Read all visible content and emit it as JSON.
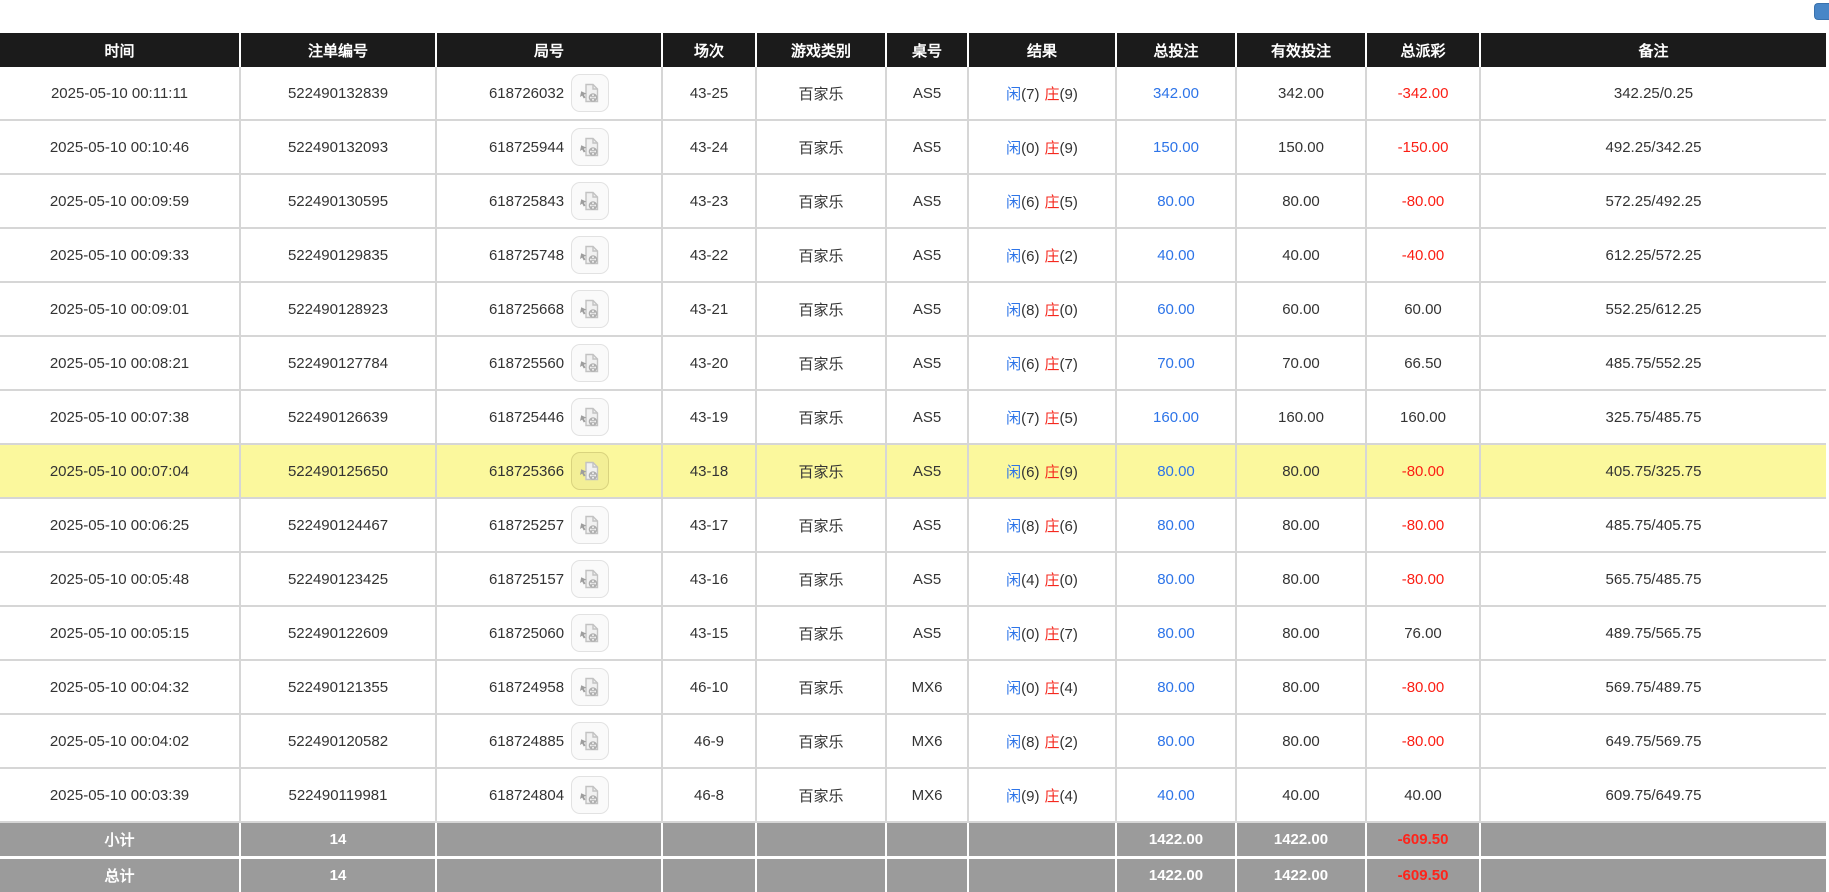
{
  "corner_tab": {
    "color": "#4886c7"
  },
  "colors": {
    "header_bg": "#1b1b1b",
    "highlight_row": "#fbf89d",
    "summary_bg": "#9b9b9b",
    "link_blue": "#2d74e8",
    "negative_red": "#fb1e14"
  },
  "result_labels": {
    "player": "闲",
    "banker": "庄"
  },
  "icons": {
    "round_action": "video-replay-icon"
  },
  "table": {
    "columns": [
      {
        "key": "time",
        "label": "时间"
      },
      {
        "key": "bet_no",
        "label": "注单编号"
      },
      {
        "key": "round_no",
        "label": "局号"
      },
      {
        "key": "session",
        "label": "场次"
      },
      {
        "key": "game",
        "label": "游戏类别"
      },
      {
        "key": "table",
        "label": "桌号"
      },
      {
        "key": "result",
        "label": "结果"
      },
      {
        "key": "total",
        "label": "总投注"
      },
      {
        "key": "valid",
        "label": "有效投注"
      },
      {
        "key": "payout",
        "label": "总派彩"
      },
      {
        "key": "remark",
        "label": "备注"
      }
    ],
    "rows": [
      {
        "time": "2025-05-10 00:11:11",
        "bet_no": "522490132839",
        "round_no": "618726032",
        "session": "43-25",
        "game": "百家乐",
        "table": "AS5",
        "player": "7",
        "banker": "9",
        "total": "342.00",
        "valid": "342.00",
        "payout": "-342.00",
        "remark": "342.25/0.25"
      },
      {
        "time": "2025-05-10 00:10:46",
        "bet_no": "522490132093",
        "round_no": "618725944",
        "session": "43-24",
        "game": "百家乐",
        "table": "AS5",
        "player": "0",
        "banker": "9",
        "total": "150.00",
        "valid": "150.00",
        "payout": "-150.00",
        "remark": "492.25/342.25"
      },
      {
        "time": "2025-05-10 00:09:59",
        "bet_no": "522490130595",
        "round_no": "618725843",
        "session": "43-23",
        "game": "百家乐",
        "table": "AS5",
        "player": "6",
        "banker": "5",
        "total": "80.00",
        "valid": "80.00",
        "payout": "-80.00",
        "remark": "572.25/492.25"
      },
      {
        "time": "2025-05-10 00:09:33",
        "bet_no": "522490129835",
        "round_no": "618725748",
        "session": "43-22",
        "game": "百家乐",
        "table": "AS5",
        "player": "6",
        "banker": "2",
        "total": "40.00",
        "valid": "40.00",
        "payout": "-40.00",
        "remark": "612.25/572.25"
      },
      {
        "time": "2025-05-10 00:09:01",
        "bet_no": "522490128923",
        "round_no": "618725668",
        "session": "43-21",
        "game": "百家乐",
        "table": "AS5",
        "player": "8",
        "banker": "0",
        "total": "60.00",
        "valid": "60.00",
        "payout": "60.00",
        "remark": "552.25/612.25"
      },
      {
        "time": "2025-05-10 00:08:21",
        "bet_no": "522490127784",
        "round_no": "618725560",
        "session": "43-20",
        "game": "百家乐",
        "table": "AS5",
        "player": "6",
        "banker": "7",
        "total": "70.00",
        "valid": "70.00",
        "payout": "66.50",
        "remark": "485.75/552.25"
      },
      {
        "time": "2025-05-10 00:07:38",
        "bet_no": "522490126639",
        "round_no": "618725446",
        "session": "43-19",
        "game": "百家乐",
        "table": "AS5",
        "player": "7",
        "banker": "5",
        "total": "160.00",
        "valid": "160.00",
        "payout": "160.00",
        "remark": "325.75/485.75"
      },
      {
        "time": "2025-05-10 00:07:04",
        "bet_no": "522490125650",
        "round_no": "618725366",
        "session": "43-18",
        "game": "百家乐",
        "table": "AS5",
        "player": "6",
        "banker": "9",
        "total": "80.00",
        "valid": "80.00",
        "payout": "-80.00",
        "remark": "405.75/325.75",
        "highlighted": true
      },
      {
        "time": "2025-05-10 00:06:25",
        "bet_no": "522490124467",
        "round_no": "618725257",
        "session": "43-17",
        "game": "百家乐",
        "table": "AS5",
        "player": "8",
        "banker": "6",
        "total": "80.00",
        "valid": "80.00",
        "payout": "-80.00",
        "remark": "485.75/405.75"
      },
      {
        "time": "2025-05-10 00:05:48",
        "bet_no": "522490123425",
        "round_no": "618725157",
        "session": "43-16",
        "game": "百家乐",
        "table": "AS5",
        "player": "4",
        "banker": "0",
        "total": "80.00",
        "valid": "80.00",
        "payout": "-80.00",
        "remark": "565.75/485.75"
      },
      {
        "time": "2025-05-10 00:05:15",
        "bet_no": "522490122609",
        "round_no": "618725060",
        "session": "43-15",
        "game": "百家乐",
        "table": "AS5",
        "player": "0",
        "banker": "7",
        "total": "80.00",
        "valid": "80.00",
        "payout": "76.00",
        "remark": "489.75/565.75"
      },
      {
        "time": "2025-05-10 00:04:32",
        "bet_no": "522490121355",
        "round_no": "618724958",
        "session": "46-10",
        "game": "百家乐",
        "table": "MX6",
        "player": "0",
        "banker": "4",
        "total": "80.00",
        "valid": "80.00",
        "payout": "-80.00",
        "remark": "569.75/489.75"
      },
      {
        "time": "2025-05-10 00:04:02",
        "bet_no": "522490120582",
        "round_no": "618724885",
        "session": "46-9",
        "game": "百家乐",
        "table": "MX6",
        "player": "8",
        "banker": "2",
        "total": "80.00",
        "valid": "80.00",
        "payout": "-80.00",
        "remark": "649.75/569.75"
      },
      {
        "time": "2025-05-10 00:03:39",
        "bet_no": "522490119981",
        "round_no": "618724804",
        "session": "46-8",
        "game": "百家乐",
        "table": "MX6",
        "player": "9",
        "banker": "4",
        "total": "40.00",
        "valid": "40.00",
        "payout": "40.00",
        "remark": "609.75/649.75"
      }
    ],
    "summary": [
      {
        "label": "小计",
        "count": "14",
        "total": "1422.00",
        "valid": "1422.00",
        "payout": "-609.50"
      },
      {
        "label": "总计",
        "count": "14",
        "total": "1422.00",
        "valid": "1422.00",
        "payout": "-609.50"
      }
    ]
  }
}
